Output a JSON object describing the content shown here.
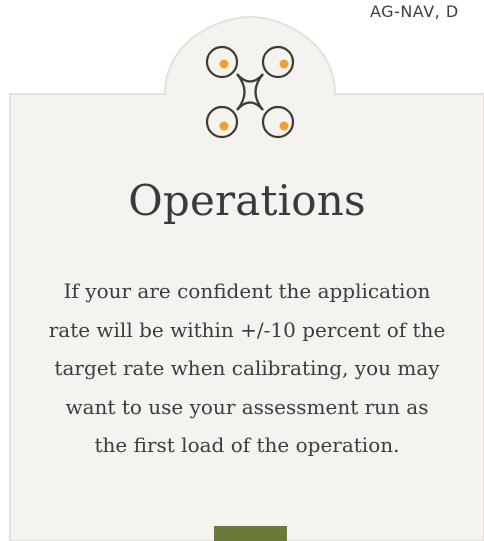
{
  "header": {
    "truncated_text": "AG-NAV, D"
  },
  "card": {
    "icon": "drone-icon",
    "title": "Operations",
    "body": "If your are confident the application rate will be within +/-10 percent of the target rate when calibrating, you may want to use your assessment run as the first load of the operation."
  },
  "colors": {
    "card_background": "#f4f3ef",
    "card_border": "#e4e1d8",
    "icon_stroke": "#3f3a33",
    "icon_dot": "#f0a030",
    "button": "#6a7a3a"
  }
}
